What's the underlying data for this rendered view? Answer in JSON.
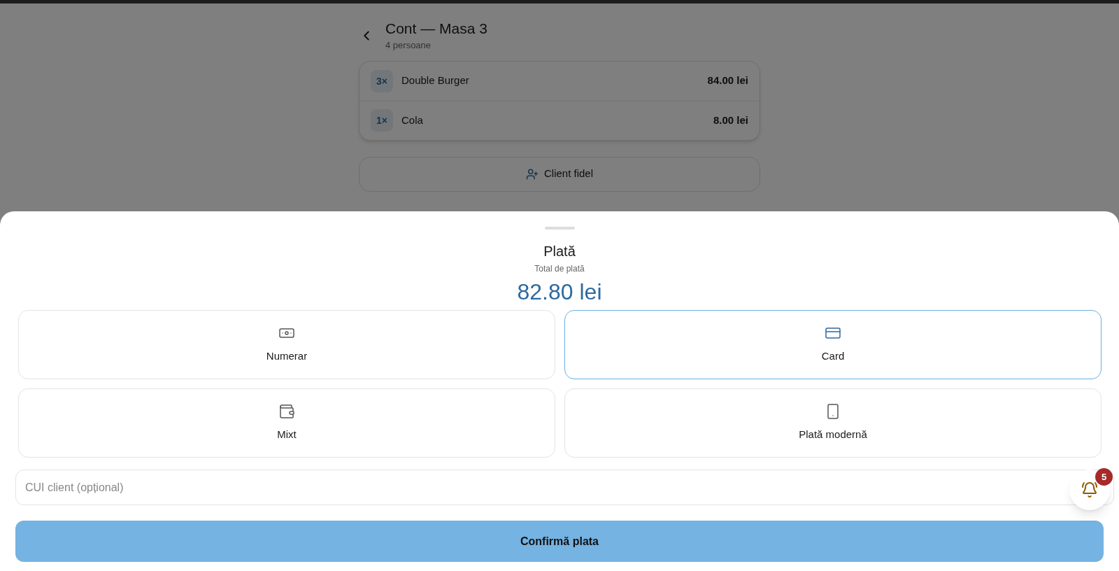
{
  "header": {
    "title": "Cont — Masa 3",
    "subtitle": "4 persoane"
  },
  "order_items": [
    {
      "quantity": "3×",
      "name": "Double Burger",
      "price": "84.00 lei"
    },
    {
      "quantity": "1×",
      "name": "Cola",
      "price": "8.00 lei"
    }
  ],
  "loyal_client_button": "Client fidel",
  "payment_sheet": {
    "title": "Plată",
    "total_label": "Total de plată",
    "total": "82.80 lei",
    "methods": [
      {
        "kind": "cash",
        "label": "Numerar",
        "selected": false
      },
      {
        "kind": "card",
        "label": "Card",
        "selected": true
      },
      {
        "kind": "mixed",
        "label": "Mixt",
        "selected": false
      },
      {
        "kind": "mobile",
        "label": "Plată modernă",
        "selected": false
      }
    ],
    "cui_field": {
      "placeholder": "CUI client (opțional)"
    },
    "confirm_button": "Confirmă plata"
  },
  "notifications": {
    "count": "5"
  }
}
